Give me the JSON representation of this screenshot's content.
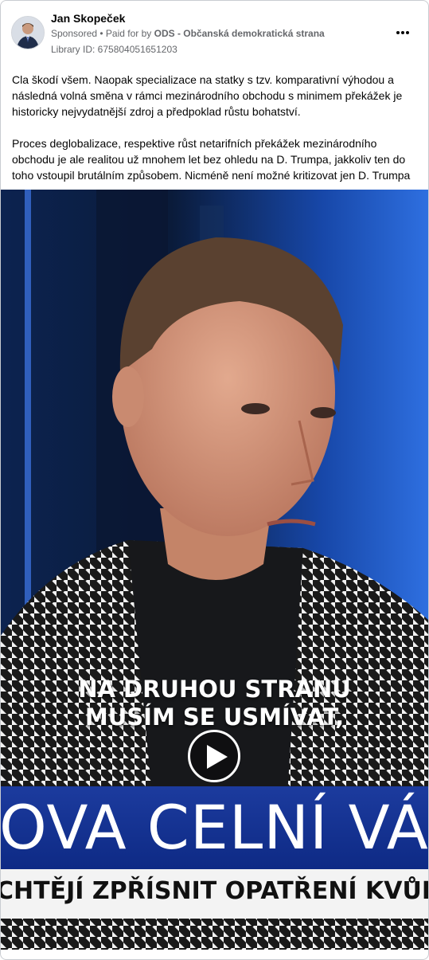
{
  "post": {
    "author": "Jan Skopeček",
    "sponsored_label": "Sponsored",
    "paid_prefix": " • Paid for by ",
    "payer": "ODS - Občanská demokratická strana",
    "library_id": "Library ID: 675804051651203"
  },
  "body": {
    "paragraph1": "Cla škodí všem. Naopak specializace na statky s tzv. komparativní výhodou a následná volná směna v rámci mezinárodního obchodu s minimem překážek je historicky nejvydatnější zdroj a předpoklad růstu bohatství.",
    "paragraph2": "Proces deglobalizace, respektive růst netarifních překážek mezinárodního obchodu je ale realitou už mnohem let bez ohledu na D. Trumpa, jakkoliv ten do toho vstoupil brutálním způsobem. Nicméně není možné kritizovat jen D. Trumpa …"
  },
  "video": {
    "caption_line1": "NA DRUHOU STRANU",
    "caption_line2": "MUSÍM SE USMÍVAT,",
    "banner": "OVA CELNÍ VÁL",
    "ticker": "CHTĚJÍ ZPŘÍSNIT OPATŘENÍ KVŮLI SLINTAVCE"
  },
  "icons": {
    "more": "more-options-icon",
    "play": "play-icon"
  }
}
